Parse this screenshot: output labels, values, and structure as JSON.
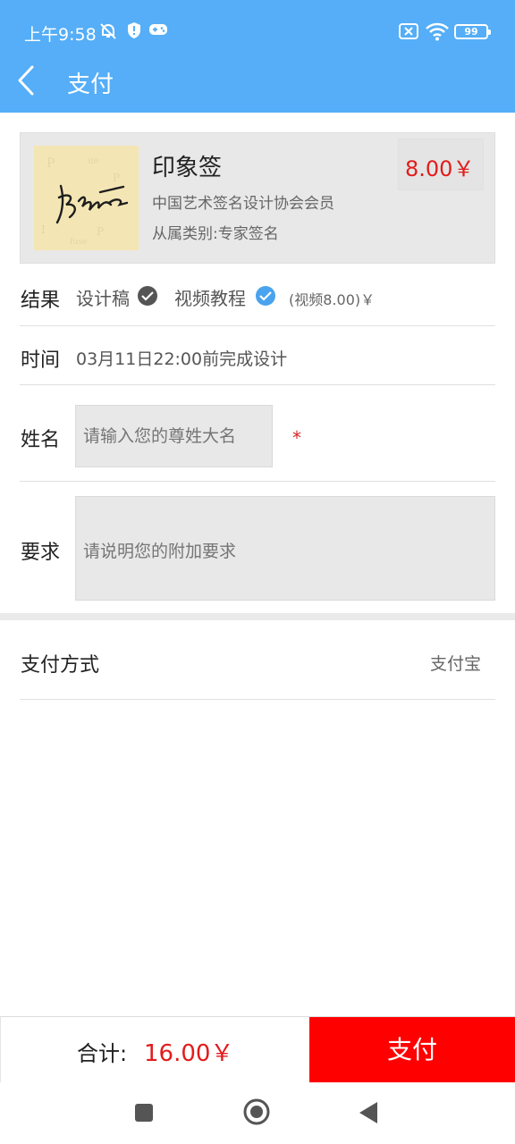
{
  "status": {
    "time": "上午9:58",
    "battery": "99"
  },
  "nav": {
    "title": "支付"
  },
  "product": {
    "name": "印象签",
    "subtitle": "中国艺术签名设计协会会员",
    "category": "从属类别:专家签名",
    "price": "8.00￥"
  },
  "result": {
    "label": "结果",
    "option1": "设计稿",
    "option2": "视频教程",
    "note": "(视频8.00)￥"
  },
  "time_row": {
    "label": "时间",
    "value": "03月11日22:00前完成设计"
  },
  "name_row": {
    "label": "姓名",
    "placeholder": "请输入您的尊姓大名",
    "required_mark": "*"
  },
  "req_row": {
    "label": "要求",
    "placeholder": "请说明您的附加要求"
  },
  "payment": {
    "label": "支付方式",
    "method": "支付宝"
  },
  "footer": {
    "total_label": "合计:",
    "total_amount": "16.00￥",
    "pay_button": "支付"
  },
  "colors": {
    "header": "#55aef7",
    "price_red": "#e31b1b",
    "pay_button": "#ff0000",
    "check_blue": "#4aa3ee"
  }
}
